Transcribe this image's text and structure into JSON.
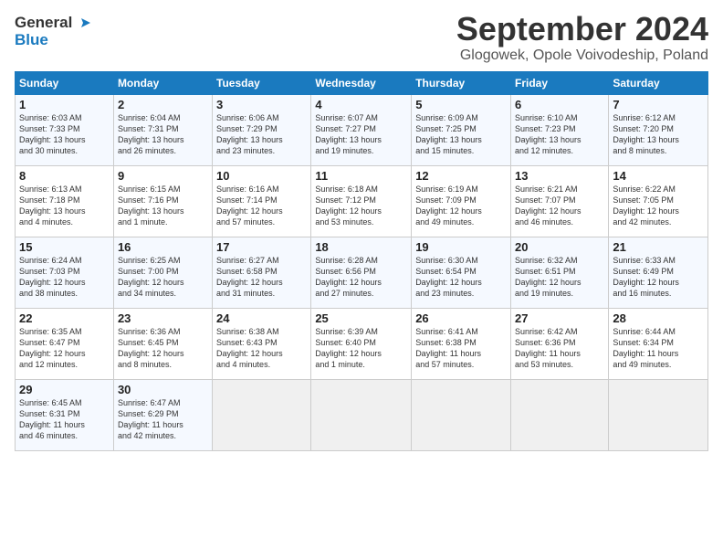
{
  "header": {
    "logo_line1": "General",
    "logo_line2": "Blue",
    "month_title": "September 2024",
    "location": "Glogowek, Opole Voivodeship, Poland"
  },
  "weekdays": [
    "Sunday",
    "Monday",
    "Tuesday",
    "Wednesday",
    "Thursday",
    "Friday",
    "Saturday"
  ],
  "weeks": [
    [
      {
        "day": "1",
        "info": "Sunrise: 6:03 AM\nSunset: 7:33 PM\nDaylight: 13 hours\nand 30 minutes."
      },
      {
        "day": "2",
        "info": "Sunrise: 6:04 AM\nSunset: 7:31 PM\nDaylight: 13 hours\nand 26 minutes."
      },
      {
        "day": "3",
        "info": "Sunrise: 6:06 AM\nSunset: 7:29 PM\nDaylight: 13 hours\nand 23 minutes."
      },
      {
        "day": "4",
        "info": "Sunrise: 6:07 AM\nSunset: 7:27 PM\nDaylight: 13 hours\nand 19 minutes."
      },
      {
        "day": "5",
        "info": "Sunrise: 6:09 AM\nSunset: 7:25 PM\nDaylight: 13 hours\nand 15 minutes."
      },
      {
        "day": "6",
        "info": "Sunrise: 6:10 AM\nSunset: 7:23 PM\nDaylight: 13 hours\nand 12 minutes."
      },
      {
        "day": "7",
        "info": "Sunrise: 6:12 AM\nSunset: 7:20 PM\nDaylight: 13 hours\nand 8 minutes."
      }
    ],
    [
      {
        "day": "8",
        "info": "Sunrise: 6:13 AM\nSunset: 7:18 PM\nDaylight: 13 hours\nand 4 minutes."
      },
      {
        "day": "9",
        "info": "Sunrise: 6:15 AM\nSunset: 7:16 PM\nDaylight: 13 hours\nand 1 minute."
      },
      {
        "day": "10",
        "info": "Sunrise: 6:16 AM\nSunset: 7:14 PM\nDaylight: 12 hours\nand 57 minutes."
      },
      {
        "day": "11",
        "info": "Sunrise: 6:18 AM\nSunset: 7:12 PM\nDaylight: 12 hours\nand 53 minutes."
      },
      {
        "day": "12",
        "info": "Sunrise: 6:19 AM\nSunset: 7:09 PM\nDaylight: 12 hours\nand 49 minutes."
      },
      {
        "day": "13",
        "info": "Sunrise: 6:21 AM\nSunset: 7:07 PM\nDaylight: 12 hours\nand 46 minutes."
      },
      {
        "day": "14",
        "info": "Sunrise: 6:22 AM\nSunset: 7:05 PM\nDaylight: 12 hours\nand 42 minutes."
      }
    ],
    [
      {
        "day": "15",
        "info": "Sunrise: 6:24 AM\nSunset: 7:03 PM\nDaylight: 12 hours\nand 38 minutes."
      },
      {
        "day": "16",
        "info": "Sunrise: 6:25 AM\nSunset: 7:00 PM\nDaylight: 12 hours\nand 34 minutes."
      },
      {
        "day": "17",
        "info": "Sunrise: 6:27 AM\nSunset: 6:58 PM\nDaylight: 12 hours\nand 31 minutes."
      },
      {
        "day": "18",
        "info": "Sunrise: 6:28 AM\nSunset: 6:56 PM\nDaylight: 12 hours\nand 27 minutes."
      },
      {
        "day": "19",
        "info": "Sunrise: 6:30 AM\nSunset: 6:54 PM\nDaylight: 12 hours\nand 23 minutes."
      },
      {
        "day": "20",
        "info": "Sunrise: 6:32 AM\nSunset: 6:51 PM\nDaylight: 12 hours\nand 19 minutes."
      },
      {
        "day": "21",
        "info": "Sunrise: 6:33 AM\nSunset: 6:49 PM\nDaylight: 12 hours\nand 16 minutes."
      }
    ],
    [
      {
        "day": "22",
        "info": "Sunrise: 6:35 AM\nSunset: 6:47 PM\nDaylight: 12 hours\nand 12 minutes."
      },
      {
        "day": "23",
        "info": "Sunrise: 6:36 AM\nSunset: 6:45 PM\nDaylight: 12 hours\nand 8 minutes."
      },
      {
        "day": "24",
        "info": "Sunrise: 6:38 AM\nSunset: 6:43 PM\nDaylight: 12 hours\nand 4 minutes."
      },
      {
        "day": "25",
        "info": "Sunrise: 6:39 AM\nSunset: 6:40 PM\nDaylight: 12 hours\nand 1 minute."
      },
      {
        "day": "26",
        "info": "Sunrise: 6:41 AM\nSunset: 6:38 PM\nDaylight: 11 hours\nand 57 minutes."
      },
      {
        "day": "27",
        "info": "Sunrise: 6:42 AM\nSunset: 6:36 PM\nDaylight: 11 hours\nand 53 minutes."
      },
      {
        "day": "28",
        "info": "Sunrise: 6:44 AM\nSunset: 6:34 PM\nDaylight: 11 hours\nand 49 minutes."
      }
    ],
    [
      {
        "day": "29",
        "info": "Sunrise: 6:45 AM\nSunset: 6:31 PM\nDaylight: 11 hours\nand 46 minutes."
      },
      {
        "day": "30",
        "info": "Sunrise: 6:47 AM\nSunset: 6:29 PM\nDaylight: 11 hours\nand 42 minutes."
      },
      {
        "day": "",
        "info": ""
      },
      {
        "day": "",
        "info": ""
      },
      {
        "day": "",
        "info": ""
      },
      {
        "day": "",
        "info": ""
      },
      {
        "day": "",
        "info": ""
      }
    ]
  ]
}
